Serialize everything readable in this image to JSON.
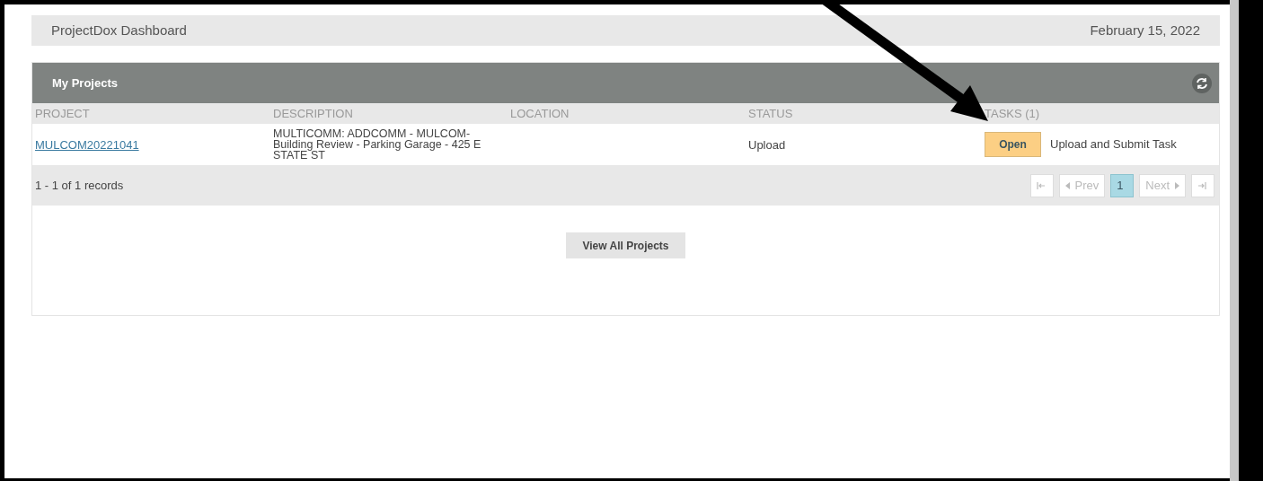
{
  "header": {
    "title": "ProjectDox Dashboard",
    "date": "February 15, 2022"
  },
  "panel": {
    "title": "My Projects",
    "columns": [
      "PROJECT",
      "DESCRIPTION",
      "LOCATION",
      "STATUS",
      "TASKS (1)"
    ],
    "rows": [
      {
        "project": "MULCOM20221041",
        "description": "MULTICOMM: ADDCOMM - MULCOM-Building Review - Parking Garage - 425 E STATE ST",
        "status": "Upload",
        "task_button": "Open",
        "task": "Upload and Submit Task"
      }
    ],
    "records": "1 - 1 of 1 records",
    "pager": [
      {
        "kind": "first",
        "disabled": true,
        "selected": false
      },
      {
        "kind": "prev",
        "label": "Prev",
        "disabled": true,
        "selected": false
      },
      {
        "kind": "page",
        "label": "1",
        "disabled": false,
        "selected": true
      },
      {
        "kind": "next",
        "label": "Next",
        "disabled": true,
        "selected": false
      },
      {
        "kind": "last",
        "disabled": true,
        "selected": false
      }
    ],
    "view_all": "View All Projects"
  }
}
